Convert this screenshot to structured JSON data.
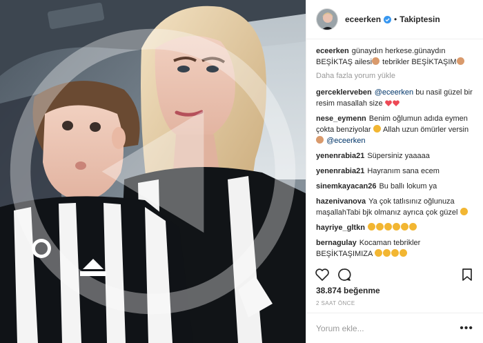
{
  "post": {
    "username": "eceerken",
    "follow_state": "Takiptesin",
    "likes": "38.874 beğenme",
    "time": "2 SAAT ÖNCE",
    "load_more": "Daha fazla yorum yükle",
    "composer_placeholder": "Yorum ekle...",
    "composer_more": "•••"
  },
  "caption": {
    "user": "eceerken",
    "text": "günaydın herkese.günaydın BEŞİKTAŞ ailesi",
    "text2": " tebrikler BEŞİKTAŞIM"
  },
  "comments": [
    {
      "user": "gerceklerveben",
      "mention": "@eceerken",
      "text": "bu nasil güzel bir resim masallah size"
    },
    {
      "user": "nese_eymenn",
      "text": "Benim oğlumun adıda eymen çokta benziyolar",
      "text2": " Allah uzun ömürler versin",
      "mention": "@eceerken"
    },
    {
      "user": "yenenrabia21",
      "text": "Süpersiniz yaaaaa"
    },
    {
      "user": "yenenrabia21",
      "text": "Hayranım sana ecem"
    },
    {
      "user": "sinemkayacan26",
      "text": "Bu ballı lokum ya"
    },
    {
      "user": "hazenivanova",
      "text": "Ya çok tatlısınız oğlunuza maşallahTabi bjk olmanız ayrıca çok güzel"
    },
    {
      "user": "hayriye_gltkn",
      "text": ""
    },
    {
      "user": "bernagulay",
      "text": "Kocaman tebrikler BEŞİKTAŞIMIZA"
    }
  ],
  "icons": [
    "like-icon",
    "comment-icon",
    "bookmark-icon",
    "verified-icon",
    "more-icon"
  ],
  "colors": {
    "mention": "#003569",
    "muted": "#999999",
    "verified": "#3897f0",
    "heart": "#ed4956",
    "text": "#262626"
  }
}
